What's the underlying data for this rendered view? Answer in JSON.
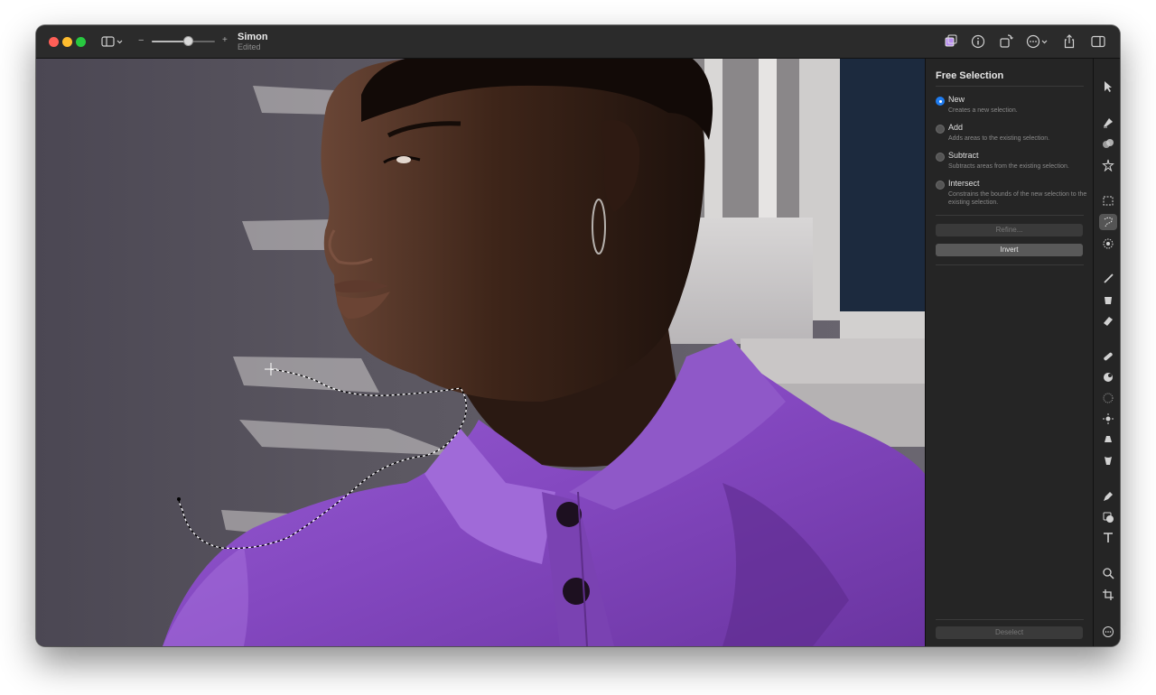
{
  "window": {
    "title": "Simon",
    "subtitle": "Edited"
  },
  "zoom": {
    "minus": "−",
    "plus": "+",
    "level": 0.57
  },
  "toolbar": {
    "icons": [
      "sidebar-toggle-icon",
      "adjust-icon",
      "info-icon",
      "rotate-icon",
      "more-icon",
      "share-icon",
      "inspector-icon"
    ]
  },
  "panel": {
    "title": "Free Selection",
    "options": [
      {
        "label": "New",
        "desc": "Creates a new selection.",
        "selected": true
      },
      {
        "label": "Add",
        "desc": "Adds areas to the existing selection.",
        "selected": false
      },
      {
        "label": "Subtract",
        "desc": "Subtracts areas from the existing selection.",
        "selected": false
      },
      {
        "label": "Intersect",
        "desc": "Constrains the bounds of the new selection to the existing selection.",
        "selected": false
      }
    ],
    "refine_label": "Refine...",
    "invert_label": "Invert",
    "deselect_label": "Deselect"
  },
  "tools": {
    "active": "free-selection-tool",
    "items": [
      "arrow-tool",
      "paint-bucket-tool",
      "blend-tool",
      "magic-wand-tool",
      "rect-selection-tool",
      "free-selection-tool",
      "quick-selection-tool",
      "brush-tool",
      "bucket-tool",
      "eraser-tool",
      "repair-tool",
      "clone-tool",
      "sharpen-tool",
      "lighten-tool",
      "smudge-tool",
      "dodge-tool",
      "pen-tool",
      "shapes-tool",
      "text-tool",
      "zoom-tool",
      "crop-tool",
      "more-tools"
    ]
  },
  "colors": {
    "accent": "#1f7cf0",
    "shirt": "#8a4fc4",
    "window_bg": "#1e1e1e"
  }
}
